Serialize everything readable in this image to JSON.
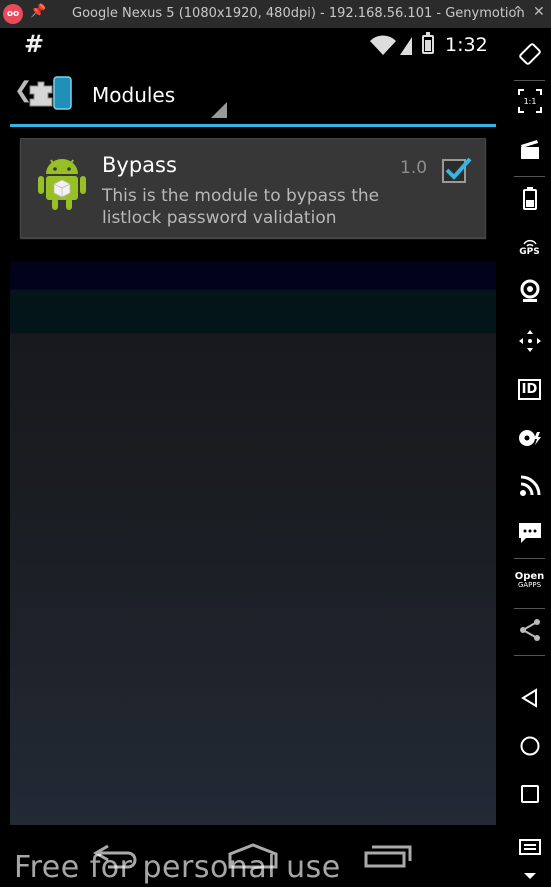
{
  "window": {
    "badge": "oo",
    "title": "Google Nexus 5 (1080x1920, 480dpi) - 192.168.56.101 - Genymotion"
  },
  "status_bar": {
    "notification_icon": "#",
    "time": "1:32"
  },
  "action_bar": {
    "title": "Modules",
    "accent_color": "#33b5e5"
  },
  "modules": [
    {
      "name": "Bypass",
      "description": "This is the module to bypass the listlock password validation",
      "version": "1.0",
      "enabled": true
    }
  ],
  "toolbar": {
    "gps_label": "GPS",
    "id_label": "ID",
    "opengapps_label_1": "Open",
    "opengapps_label_2": "GAPPS",
    "ratio_label": "1:1"
  },
  "watermark": "Free for personal use"
}
